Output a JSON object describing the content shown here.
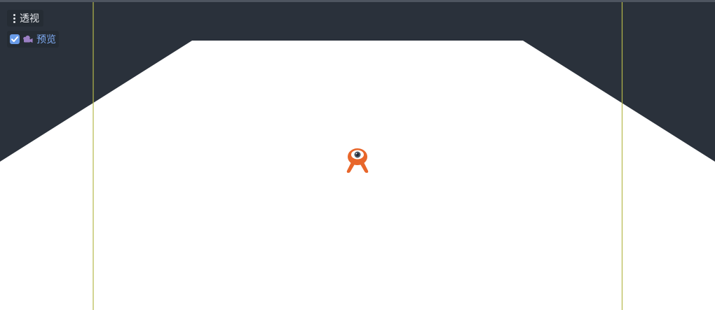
{
  "viewport_menu": {
    "menu_icon": "kebab-vertical-icon",
    "view_mode_label": "透视"
  },
  "preview_toggle": {
    "checked": true,
    "camera_icon": "camera-icon",
    "label": "预览"
  },
  "scene": {
    "background_color": "#2a313b",
    "floor_color": "#ffffff",
    "guide_line_color": "#b5b84a",
    "gizmo_color": "#e8662a",
    "gizmo_icon": "camera-gizmo-icon"
  }
}
